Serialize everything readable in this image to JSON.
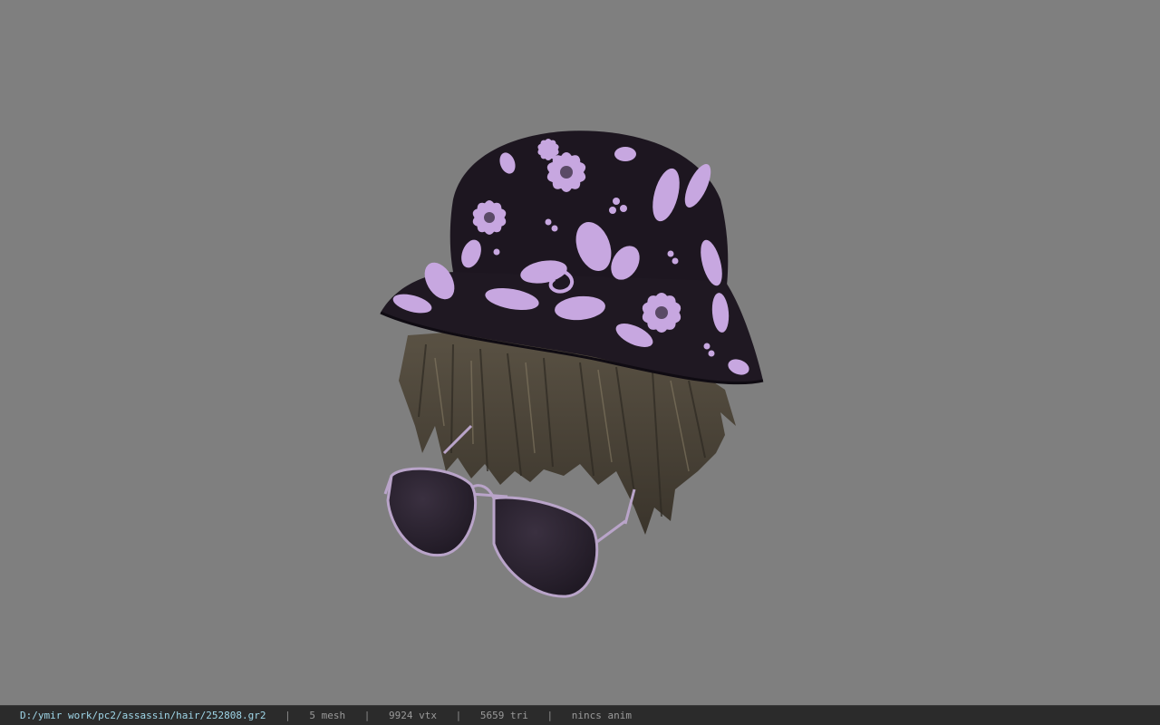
{
  "viewport": {
    "background_color": "#7f7f7f",
    "model": {
      "parts": [
        "bucket-hat",
        "hair",
        "sunglasses"
      ],
      "hat_base_color": "#1d1620",
      "hat_print_color": "#c7a7e0",
      "hair_color": "#4d463a",
      "glasses_frame_color": "#b9a4c9",
      "glasses_lens_color": "#241d28"
    }
  },
  "status_bar": {
    "file_path": "D:/ymir work/pc2/assassin/hair/252808.gr2",
    "separator": "|",
    "mesh": "5 mesh",
    "vertices": "9924 vtx",
    "triangles": "5659 tri",
    "animation": "nincs anim"
  }
}
